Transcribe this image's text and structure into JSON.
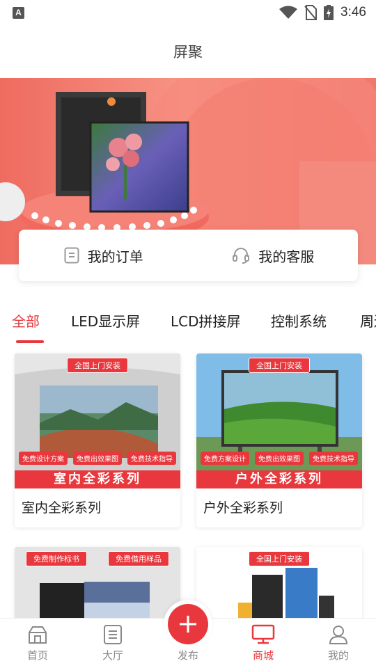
{
  "status_bar": {
    "time": "3:46",
    "notification_icon": "A"
  },
  "header": {
    "title": "屏聚"
  },
  "quick_actions": [
    {
      "label": "我的订单",
      "icon": "order-icon"
    },
    {
      "label": "我的客服",
      "icon": "headset-icon"
    }
  ],
  "tabs": [
    {
      "label": "全部",
      "active": true
    },
    {
      "label": "LED显示屏",
      "active": false
    },
    {
      "label": "LCD拼接屏",
      "active": false
    },
    {
      "label": "控制系统",
      "active": false
    },
    {
      "label": "周边",
      "active": false
    }
  ],
  "products": [
    {
      "name": "室内全彩系列",
      "badge": "全国上门安装",
      "strip": "室内全彩系列",
      "tags": [
        "免费设计方案",
        "免费出效果图",
        "免费技术指导"
      ]
    },
    {
      "name": "户外全彩系列",
      "badge": "全国上门安装",
      "strip": "户外全彩系列",
      "tags": [
        "免费方案设计",
        "免费出效果图",
        "免费技术指导"
      ]
    },
    {
      "name": "",
      "badge": "免费制作标书",
      "badge2": "免费借用样品"
    },
    {
      "name": "",
      "badge": "全国上门安装"
    }
  ],
  "bottom_nav": [
    {
      "label": "首页",
      "icon": "home-icon",
      "active": false
    },
    {
      "label": "大厅",
      "icon": "list-icon",
      "active": false
    },
    {
      "label": "发布",
      "icon": "plus-icon",
      "active": false
    },
    {
      "label": "商城",
      "icon": "monitor-icon",
      "active": true
    },
    {
      "label": "我的",
      "icon": "user-icon",
      "active": false
    }
  ],
  "colors": {
    "accent": "#e8383d",
    "banner": "#f3756a"
  }
}
